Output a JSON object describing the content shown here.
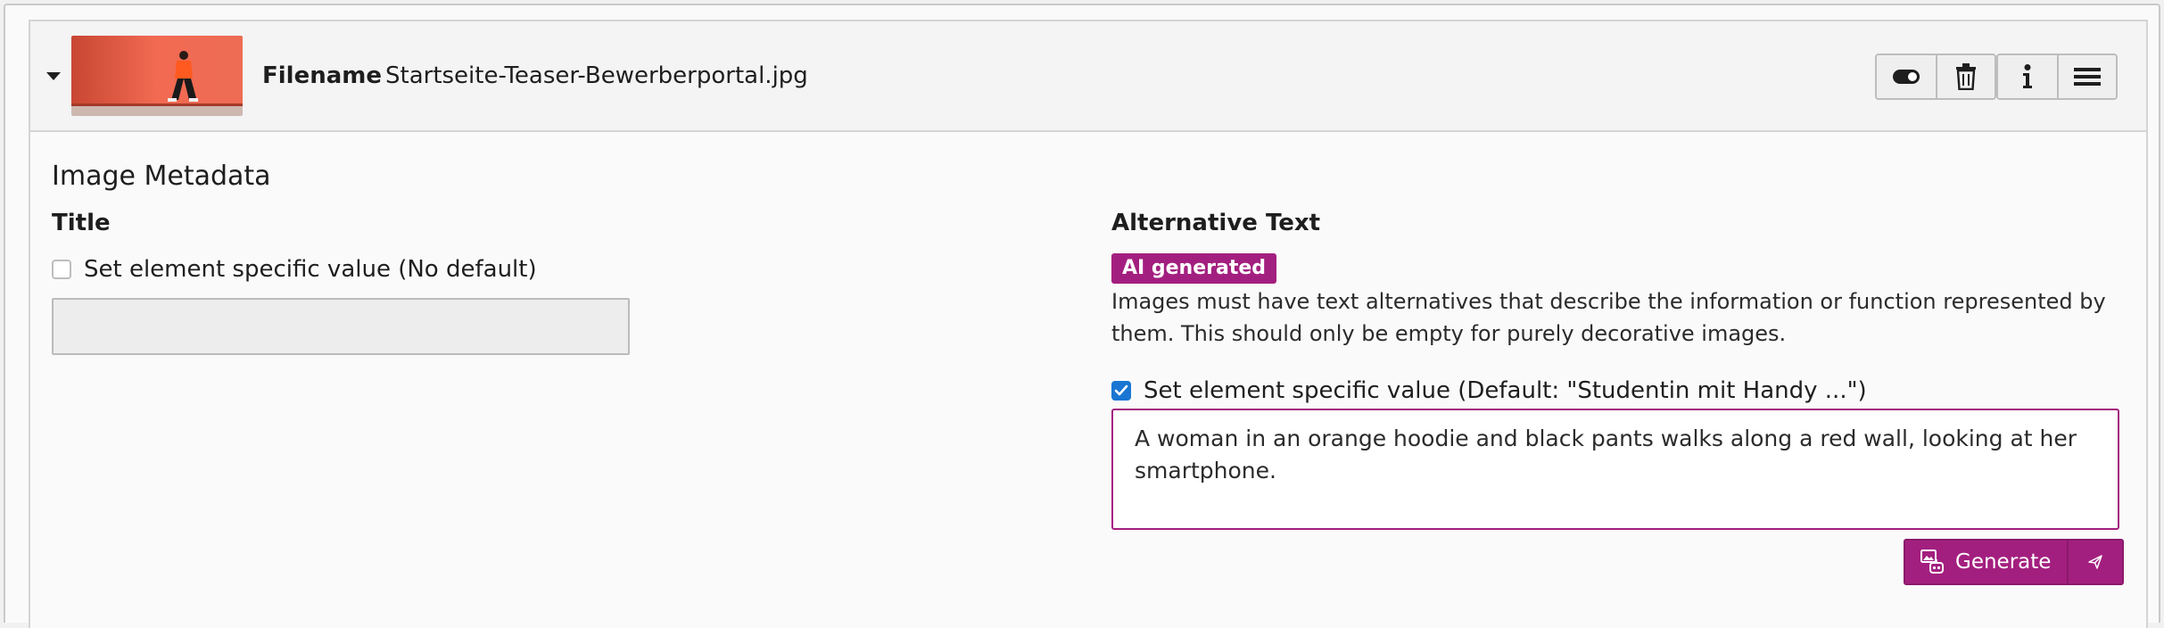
{
  "header": {
    "filename_label": "Filename",
    "filename_value": "Startseite-Teaser-Bewerberportal.jpg",
    "buttons": [
      "toggle-icon",
      "trash-icon",
      "info-icon",
      "menu-icon"
    ]
  },
  "metadata": {
    "section_title": "Image Metadata",
    "title_field": {
      "label": "Title",
      "checkbox_label": "Set element specific value (No default)",
      "checked": false,
      "value": ""
    },
    "alt_field": {
      "label": "Alternative Text",
      "badge": "AI generated",
      "help": "Images must have text alternatives that describe the information or function represented by them. This should only be empty for purely decorative images.",
      "checkbox_label": "Set element specific value (Default: \"Studentin mit Handy ...\")",
      "checked": true,
      "value": "A woman in an orange hoodie and black pants walks along a red wall, looking at her smartphone."
    },
    "generate_button": "Generate"
  },
  "colors": {
    "accent": "#a31f7f",
    "checkbox_blue": "#1a76d2",
    "header_bg": "#f4f4f4"
  }
}
